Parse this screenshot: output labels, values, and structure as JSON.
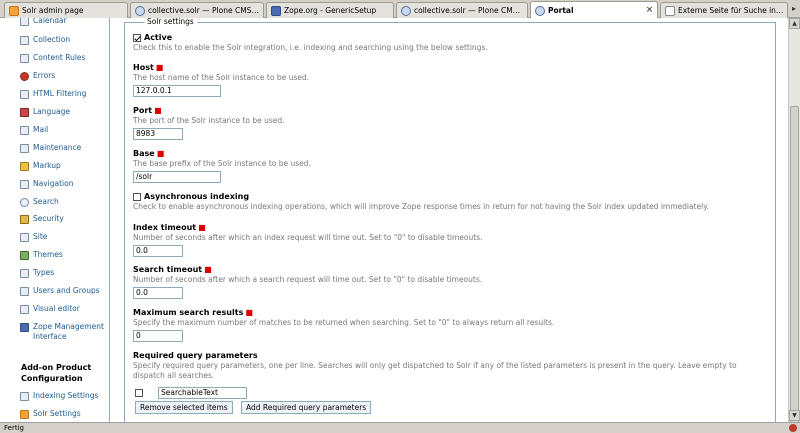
{
  "tabs": [
    {
      "label": "Solr admin page",
      "icon": "solr"
    },
    {
      "label": "collective.solr — Plone CMS: O...",
      "icon": "plone"
    },
    {
      "label": "Zope.org - GenericSetup",
      "icon": "zope"
    },
    {
      "label": "collective.solr — Plone CMS: O...",
      "icon": "plone"
    },
    {
      "label": "Portal",
      "icon": "plone"
    },
    {
      "label": "Externe Seite für Suche indizie...",
      "icon": "ext"
    }
  ],
  "sidebar": {
    "items": [
      {
        "label": "Calendar"
      },
      {
        "label": "Collection"
      },
      {
        "label": "Content Rules"
      },
      {
        "label": "Errors"
      },
      {
        "label": "HTML Filtering"
      },
      {
        "label": "Language"
      },
      {
        "label": "Mail"
      },
      {
        "label": "Maintenance"
      },
      {
        "label": "Markup"
      },
      {
        "label": "Navigation"
      },
      {
        "label": "Search"
      },
      {
        "label": "Security"
      },
      {
        "label": "Site"
      },
      {
        "label": "Themes"
      },
      {
        "label": "Types"
      },
      {
        "label": "Users and Groups"
      },
      {
        "label": "Visual editor"
      },
      {
        "label": "Zope Management Interface"
      }
    ],
    "addon_heading": "Add-on Product Configuration",
    "addon_items": [
      {
        "label": "Indexing Settings"
      },
      {
        "label": "Solr Settings"
      }
    ]
  },
  "form": {
    "legend": "Solr settings",
    "active": {
      "label": "Active",
      "help": "Check this to enable the Solr integration, i.e. indexing and searching using the below settings."
    },
    "host": {
      "label": "Host",
      "help": "The host name of the Solr instance to be used.",
      "value": "127.0.0.1"
    },
    "port": {
      "label": "Port",
      "help": "The port of the Solr instance to be used.",
      "value": "8983"
    },
    "base": {
      "label": "Base",
      "help": "The base prefix of the Solr instance to be used.",
      "value": "/solr"
    },
    "async": {
      "label": "Asynchronous indexing",
      "help": "Check to enable asynchronous indexing operations, which will improve Zope response times in return for not having the Solr index updated immediately."
    },
    "index_timeout": {
      "label": "Index timeout",
      "help": "Number of seconds after which an index request will time out. Set to \"0\" to disable timeouts.",
      "value": "0.0"
    },
    "search_timeout": {
      "label": "Search timeout",
      "help": "Number of seconds after which a search request will time out. Set to \"0\" to disable timeouts.",
      "value": "0.0"
    },
    "max_results": {
      "label": "Maximum search results",
      "help": "Specify the maximum number of matches to be returned when searching. Set to \"0\" to always return all results.",
      "value": "0"
    },
    "required_params": {
      "label": "Required query parameters",
      "help": "Specify required query parameters, one per line. Searches will only get dispatched to Solr if any of the listed parameters is present in the query. Leave empty to dispatch all searches.",
      "item_value": "SearchableText",
      "remove_label": "Remove selected items",
      "add_label": "Add Required query parameters"
    }
  },
  "status": {
    "text": "Fertig"
  }
}
